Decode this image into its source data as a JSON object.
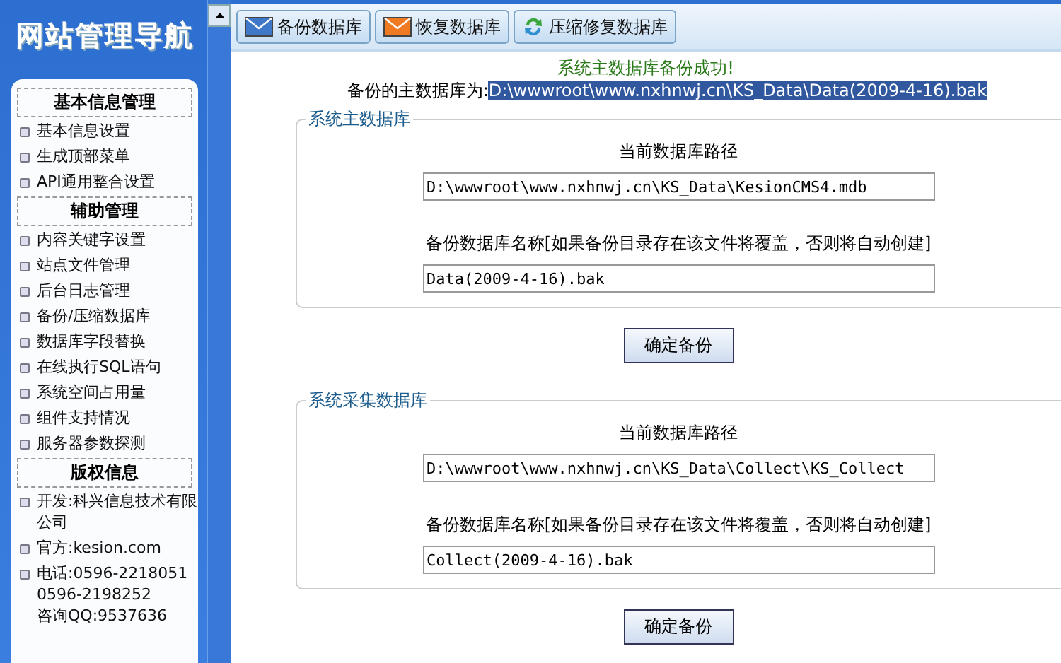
{
  "sidebar": {
    "title": "网站管理导航",
    "groups": [
      {
        "title": "基本信息管理",
        "items": [
          "基本信息设置",
          "生成顶部菜单",
          "API通用整合设置"
        ]
      },
      {
        "title": "辅助管理",
        "items": [
          "内容关键字设置",
          "站点文件管理",
          "后台日志管理",
          "备份/压缩数据库",
          "数据库字段替换",
          "在线执行SQL语句",
          "系统空间占用量",
          "组件支持情况",
          "服务器参数探测"
        ]
      },
      {
        "title": "版权信息",
        "items": [
          "开发:科兴信息技术有限公司",
          "官方:kesion.com",
          "电话:0596-2218051\n0596-2198252\n咨询QQ:9537636"
        ]
      }
    ]
  },
  "toolbar": {
    "buttons": [
      {
        "label": "备份数据库",
        "kind": "envelope",
        "color": "#3f78c8"
      },
      {
        "label": "恢复数据库",
        "kind": "envelope",
        "color": "#f07a22"
      },
      {
        "label": "压缩修复数据库",
        "kind": "recycle"
      }
    ]
  },
  "status": {
    "message": "系统主数据库备份成功!",
    "path_label": "备份的主数据库为:",
    "path_value": "D:\\wwwroot\\www.nxhnwj.cn\\KS_Data\\Data(2009-4-16).bak"
  },
  "sections": [
    {
      "legend": "系统主数据库",
      "current_label": "当前数据库路径",
      "current_path": "D:\\wwwroot\\www.nxhnwj.cn\\KS_Data\\KesionCMS4.mdb",
      "name_label": "备份数据库名称[如果备份目录存在该文件将覆盖，否则将自动创建]",
      "name_value": "Data(2009-4-16).bak",
      "button": "确定备份"
    },
    {
      "legend": "系统采集数据库",
      "current_label": "当前数据库路径",
      "current_path": "D:\\wwwroot\\www.nxhnwj.cn\\KS_Data\\Collect\\KS_Collect",
      "name_label": "备份数据库名称[如果备份目录存在该文件将覆盖，否则将自动创建]",
      "name_value": "Collect(2009-4-16).bak",
      "button": "确定备份"
    }
  ]
}
